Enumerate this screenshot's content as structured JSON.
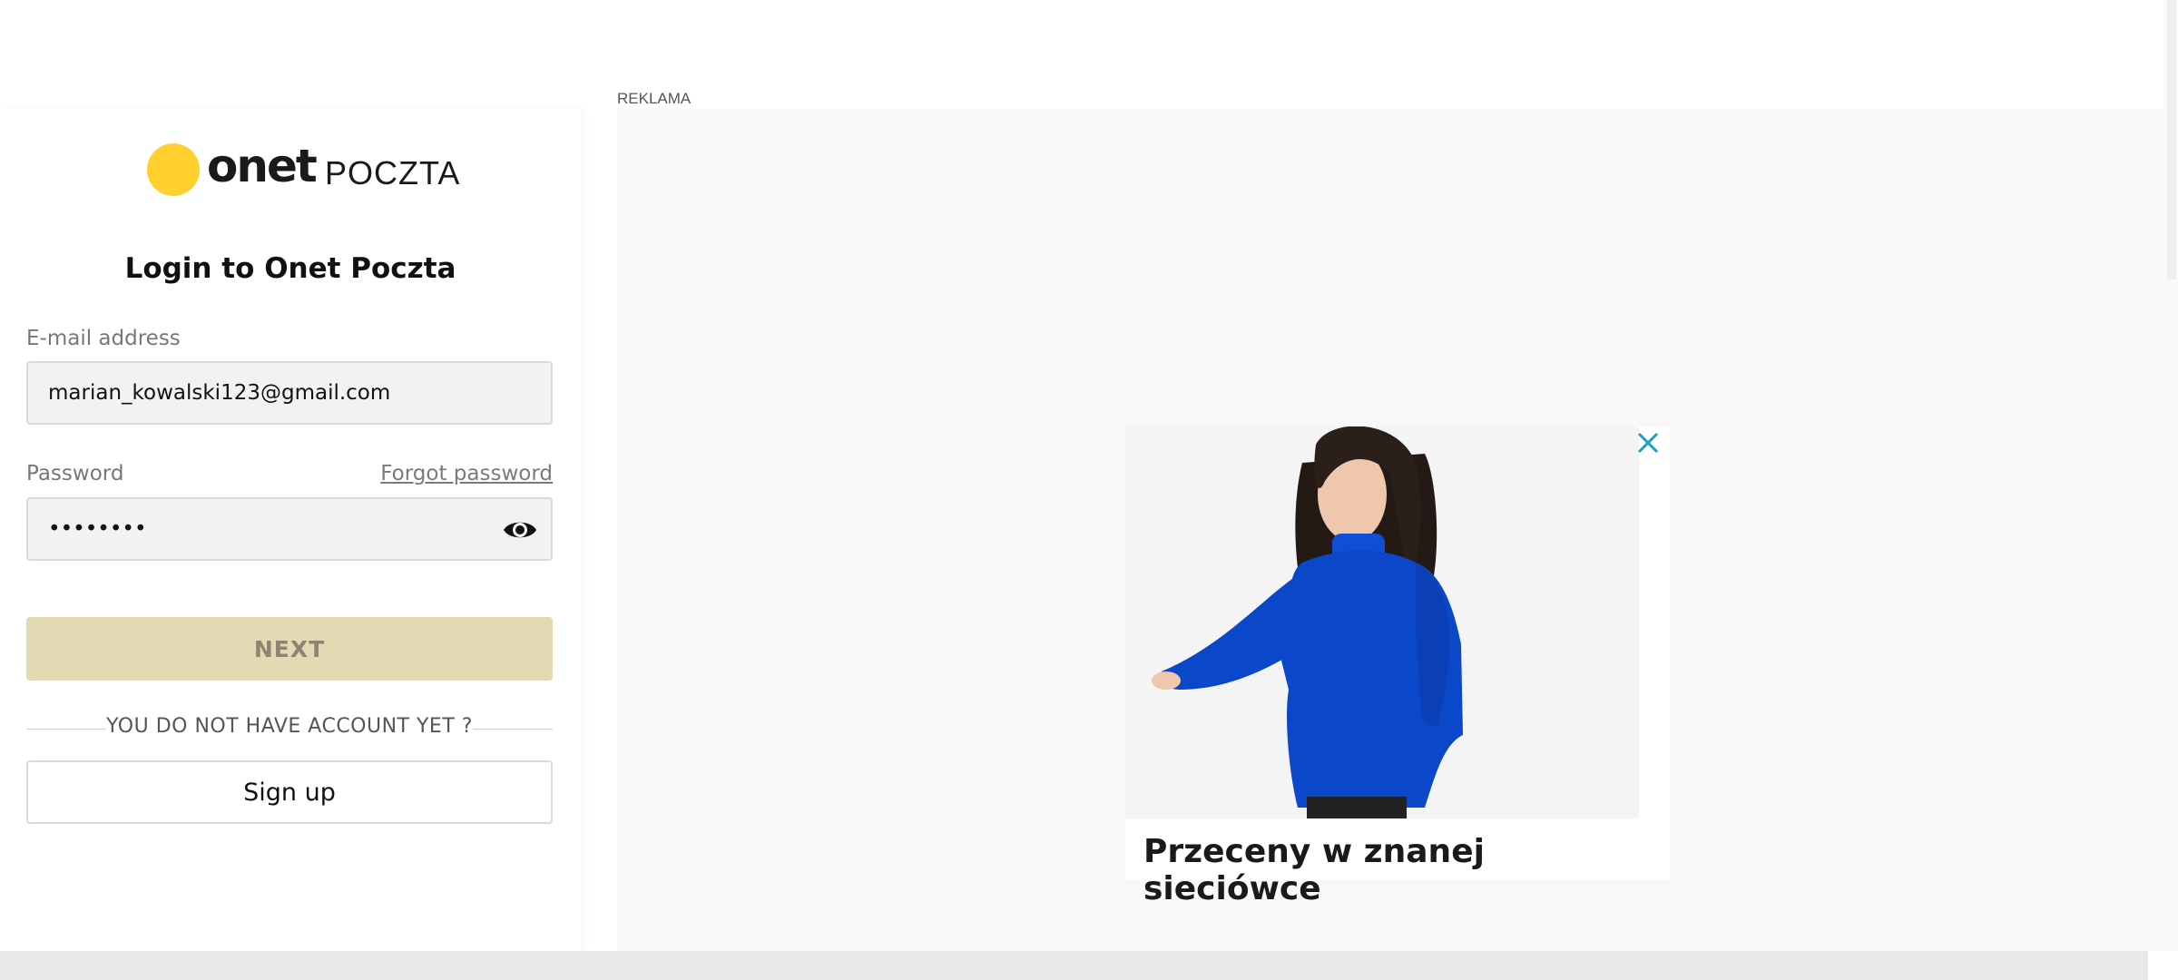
{
  "logo": {
    "brand": "onet",
    "service": "POCZTA",
    "brand_color": "#ffd02e"
  },
  "login": {
    "title": "Login to Onet Poczta",
    "email_label": "E-mail address",
    "email_value": "marian_kowalski123@gmail.com",
    "password_label": "Password",
    "forgot_password": "Forgot password",
    "password_value": "••••••••",
    "next_label": "NEXT",
    "no_account_text": "YOU DO NOT HAVE ACCOUNT YET ?",
    "signup_label": "Sign up"
  },
  "ad": {
    "label": "REKLAMA",
    "caption": "Przeceny w znanej sieciówce",
    "sweater_color": "#0a47c9",
    "close_color": "#1aa0c8"
  }
}
